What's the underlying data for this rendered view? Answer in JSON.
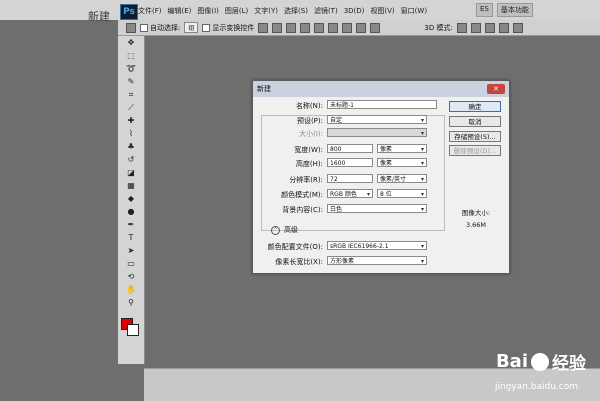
{
  "background_text": "新建",
  "app": {
    "logo": "Ps",
    "accent": "#38aef0"
  },
  "menu": [
    "文件(F)",
    "编辑(E)",
    "图像(I)",
    "图层(L)",
    "文字(Y)",
    "选择(S)",
    "滤镜(T)",
    "3D(D)",
    "视图(V)",
    "窗口(W)"
  ],
  "window_tags": [
    "ES",
    "基本功能"
  ],
  "options_bar": {
    "auto_select_label": "自动选择:",
    "auto_select_value": "组",
    "show_transform_label": "显示变换控件",
    "mode_3d_label": "3D 模式:"
  },
  "colors": {
    "foreground": "#e00000",
    "background": "#ffffff"
  },
  "dialog": {
    "title": "新建",
    "close": "✕",
    "name_label": "名称(N):",
    "name_value": "未标题-1",
    "preset_label": "预设(P):",
    "preset_value": "自定",
    "size_label": "大小(I):",
    "width_label": "宽度(W):",
    "width_value": "800",
    "width_unit": "像素",
    "height_label": "高度(H):",
    "height_value": "1600",
    "height_unit": "像素",
    "resolution_label": "分辨率(R):",
    "resolution_value": "72",
    "resolution_unit": "像素/英寸",
    "color_mode_label": "颜色模式(M):",
    "color_mode_value": "RGB 颜色",
    "bit_depth_value": "8 位",
    "background_label": "背景内容(C):",
    "background_value": "白色",
    "advanced_label": "高级",
    "profile_label": "颜色配置文件(O):",
    "profile_value": "sRGB IEC61966-2.1",
    "aspect_label": "像素长宽比(X):",
    "aspect_value": "方形像素",
    "ok": "确定",
    "cancel": "取消",
    "save_preset": "存储预设(S)...",
    "delete_preset": "删除预设(D)...",
    "image_size_label": "图像大小:",
    "image_size_value": "3.66M"
  },
  "watermark": {
    "brand": "Bai",
    "brand_suffix": "经验",
    "url": "jingyan.baidu.com"
  }
}
